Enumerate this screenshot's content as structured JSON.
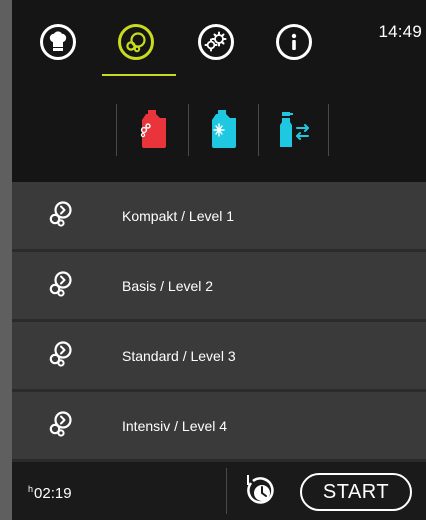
{
  "topbar": {
    "clock": "14:49",
    "nav": [
      {
        "icon": "chef-hat-icon",
        "active": false
      },
      {
        "icon": "cleaning-icon",
        "active": true
      },
      {
        "icon": "settings-gears-icon",
        "active": false
      },
      {
        "icon": "info-icon",
        "active": false
      }
    ],
    "accent_color": "#c8dc1e"
  },
  "subtabs": [
    {
      "icon": "cleaner-canister-red-icon",
      "color": "#e8343a"
    },
    {
      "icon": "cleaner-canister-cyan-icon",
      "color": "#1ec8e0"
    },
    {
      "icon": "spray-bottle-swap-icon",
      "color": "#1ec8e0"
    }
  ],
  "programs": [
    {
      "label": "Kompakt / Level 1",
      "icon": "cleaning-program-icon"
    },
    {
      "label": "Basis / Level 2",
      "icon": "cleaning-program-icon"
    },
    {
      "label": "Standard / Level 3",
      "icon": "cleaning-program-icon"
    },
    {
      "label": "Intensiv / Level 4",
      "icon": "cleaning-program-icon"
    }
  ],
  "bottombar": {
    "duration_prefix": "h",
    "duration": "02:19",
    "timer_icon": "delay-timer-icon",
    "start_label": "START"
  }
}
